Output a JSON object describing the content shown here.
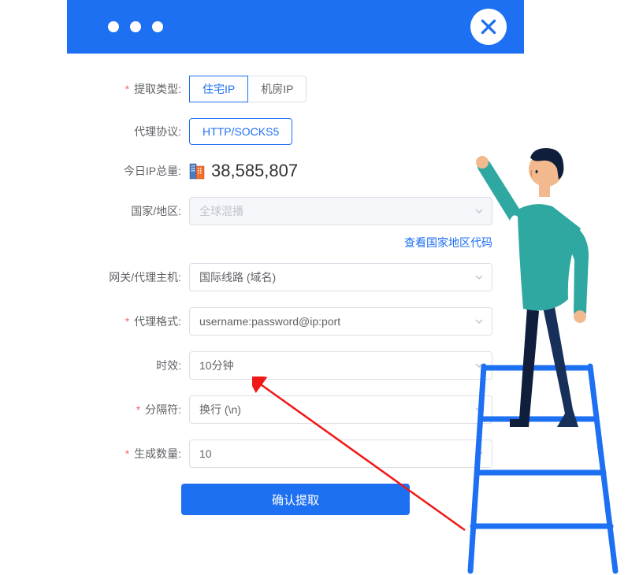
{
  "form": {
    "extract_type": {
      "label": "提取类型:",
      "options": [
        "住宅IP",
        "机房IP"
      ],
      "selected": "住宅IP"
    },
    "protocol": {
      "label": "代理协议:",
      "options": [
        "HTTP/SOCKS5"
      ],
      "selected": "HTTP/SOCKS5"
    },
    "ip_total": {
      "label": "今日IP总量:",
      "value": "38,585,807"
    },
    "region": {
      "label": "国家/地区:",
      "value": "全球混播",
      "link": "查看国家地区代码"
    },
    "gateway": {
      "label": "网关/代理主机:",
      "value": "国际线路 (域名)"
    },
    "format": {
      "label": "代理格式:",
      "value": "username:password@ip:port"
    },
    "duration": {
      "label": "时效:",
      "value": "10分钟"
    },
    "separator": {
      "label": "分隔符:",
      "value": "换行 (\\n)"
    },
    "count": {
      "label": "生成数量:",
      "value": "10"
    },
    "submit": "确认提取"
  }
}
